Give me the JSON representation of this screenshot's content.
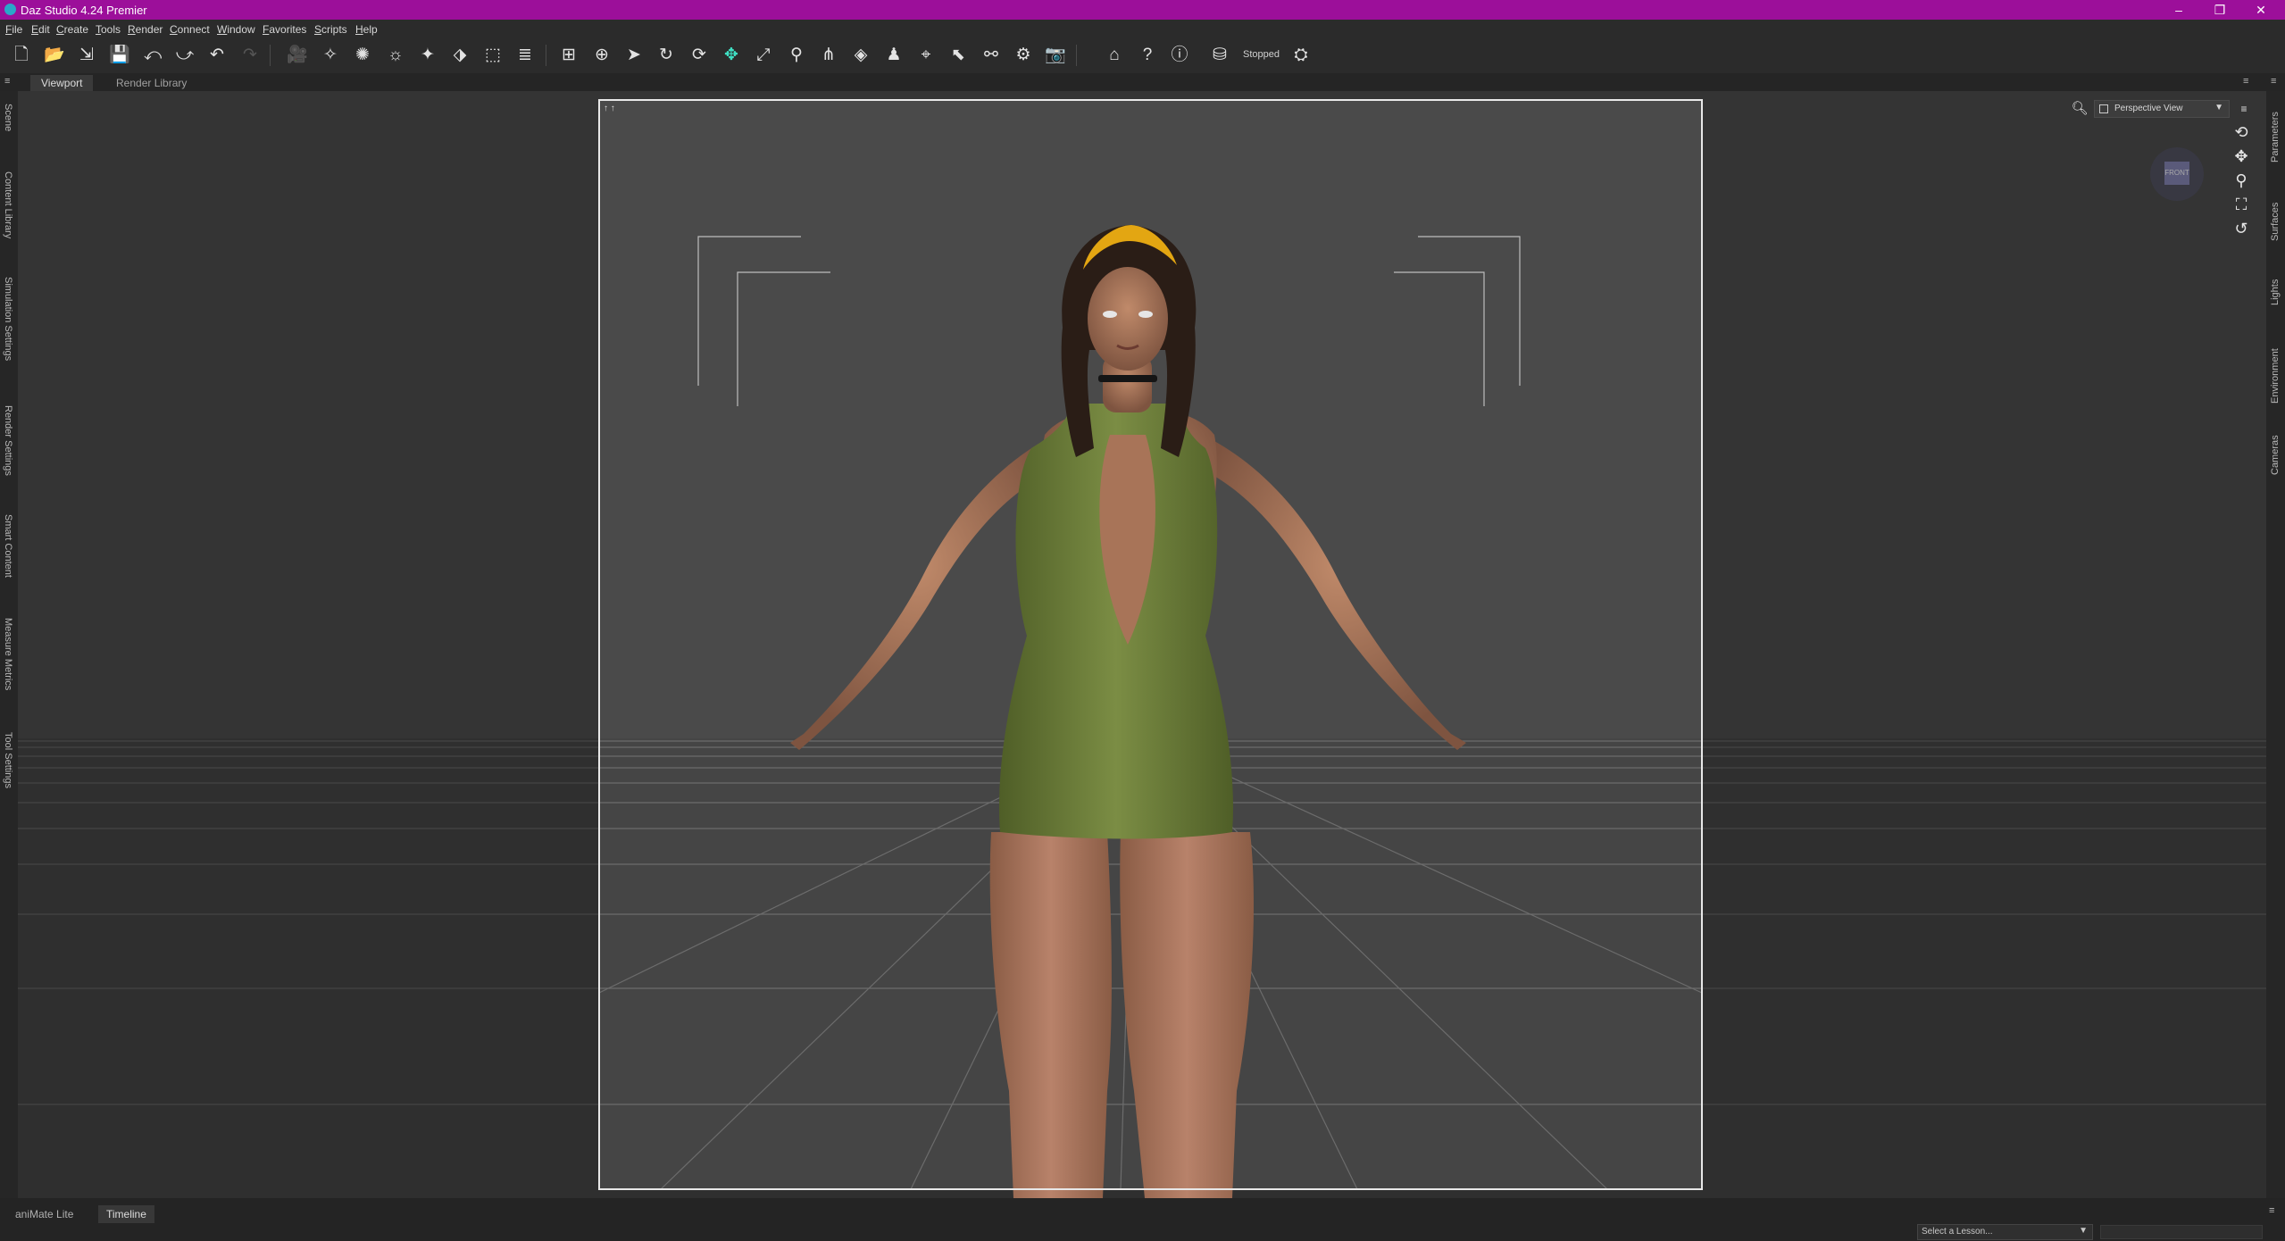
{
  "window": {
    "title": "Daz Studio 4.24 Premier",
    "minimize": "–",
    "restore": "❐",
    "close": "✕"
  },
  "menu": [
    "File",
    "Edit",
    "Create",
    "Tools",
    "Render",
    "Connect",
    "Window",
    "Favorites",
    "Scripts",
    "Help"
  ],
  "toolbar": {
    "status": "Stopped"
  },
  "tabs": {
    "viewport": "Viewport",
    "render_library": "Render Library"
  },
  "left_dock": [
    "Scene",
    "Content Library",
    "Simulation Settings",
    "Render Settings",
    "Smart Content",
    "Measure Metrics",
    "Tool Settings"
  ],
  "right_dock": [
    "Parameters",
    "Surfaces",
    "Lights",
    "Environment",
    "Cameras"
  ],
  "viewport": {
    "camera": "Perspective View",
    "frame_marker": "↑ ↑",
    "cube_label": "FRONT"
  },
  "bottom": {
    "tabs": [
      "aniMate Lite",
      "Timeline"
    ],
    "lesson_placeholder": "Select a Lesson..."
  },
  "colors": {
    "titlebar": "#9c0f9a",
    "active_tool": "#3fe0c4",
    "dress": "#6b7d3a",
    "skin": "#b07c5e",
    "hair": "#2a1d16",
    "flowers": "#e3a612"
  }
}
